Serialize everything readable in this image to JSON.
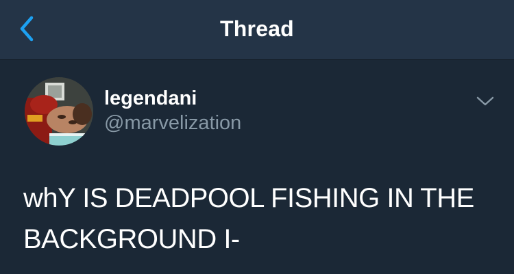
{
  "nav": {
    "title": "Thread",
    "back_icon": "chevron-left-icon",
    "accent_color": "#1da1f2"
  },
  "tweet": {
    "display_name": "legendani",
    "handle": "@marvelization",
    "text": "whY IS DEADPOOL FISHING IN THE BACKGROUND I-",
    "more_icon": "chevron-down-icon"
  },
  "colors": {
    "background": "#1b2836",
    "nav_background": "#243447",
    "primary_text": "#ffffff",
    "secondary_text": "#8899a6"
  }
}
